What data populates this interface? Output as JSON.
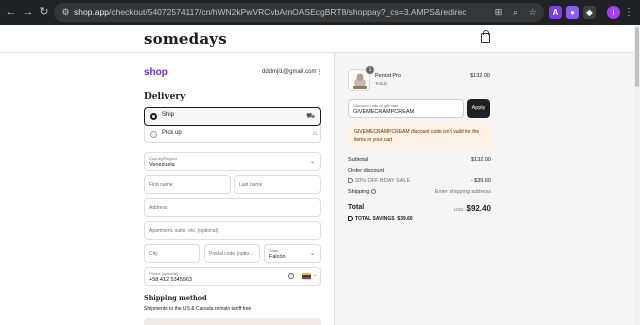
{
  "browser": {
    "url_host": "shop.app",
    "url_rest": "/checkout/54072574117/cn/hWN2kPwVRCvbAmOASEcgBRT8/shoppay?_cs=3.AMPS&redirect_source=checkout_automatic_redirect&...",
    "extensions": [
      {
        "letter": "A",
        "color": "#7b3fe4"
      },
      {
        "letter": "●",
        "color": "#8a5cf6"
      },
      {
        "letter": "◆",
        "color": "#3c4043"
      }
    ],
    "profile_initial": "i"
  },
  "header": {
    "logo": "somedays",
    "cart_icon": "shopping-bag-icon"
  },
  "account": {
    "shop_logo": "shop",
    "email": "dddmjl1@gmail.com",
    "menu_glyph": "⋮"
  },
  "delivery": {
    "heading": "Delivery",
    "options": [
      {
        "label": "Ship",
        "selected": true,
        "icon": "truck-icon"
      },
      {
        "label": "Pick up",
        "selected": false,
        "icon": "store-icon"
      }
    ],
    "country": {
      "label": "Country/Region",
      "value": "Venezuela"
    },
    "first_name": {
      "placeholder": "First name"
    },
    "last_name": {
      "placeholder": "Last name"
    },
    "address": {
      "placeholder": "Address"
    },
    "apartment": {
      "placeholder": "Apartment, suite, etc. (optional)"
    },
    "city": {
      "placeholder": "City"
    },
    "postal": {
      "placeholder": "Postal code (optio..."
    },
    "state": {
      "label": "State",
      "value": "Falcón"
    },
    "phone": {
      "label": "Phone (optional)",
      "value": "+58 412 5345963"
    }
  },
  "shipping_method": {
    "heading": "Shipping method",
    "note": "Shipments to the US & Canada remain tariff free"
  },
  "cart": {
    "item": {
      "name": "Period Pro",
      "variant": "Teddy",
      "price": "$132.00",
      "quantity": "1"
    },
    "discount": {
      "label": "Discount code or gift card",
      "value": "GIVEMECRAMPCREAM",
      "apply_label": "Apply",
      "error": "GIVEMECRAMPCREAM discount code isn't valid for the items in your cart"
    },
    "summary": {
      "subtotal_label": "Subtotal",
      "subtotal_value": "$132.00",
      "order_discount_label": "Order discount",
      "discount_name": "30% OFF BDAY SALE",
      "discount_value": "- $39.60",
      "shipping_label": "Shipping",
      "shipping_value": "Enter shipping address",
      "total_label": "Total",
      "currency": "USD",
      "total_value": "$92.40",
      "savings_label": "TOTAL SAVINGS",
      "savings_value": "$39.60"
    }
  },
  "colors": {
    "shop_brand": "#5a31f4",
    "error_bg": "#fff3e5",
    "error_text": "#6a2b00",
    "button_dark": "#1f1f1f"
  }
}
